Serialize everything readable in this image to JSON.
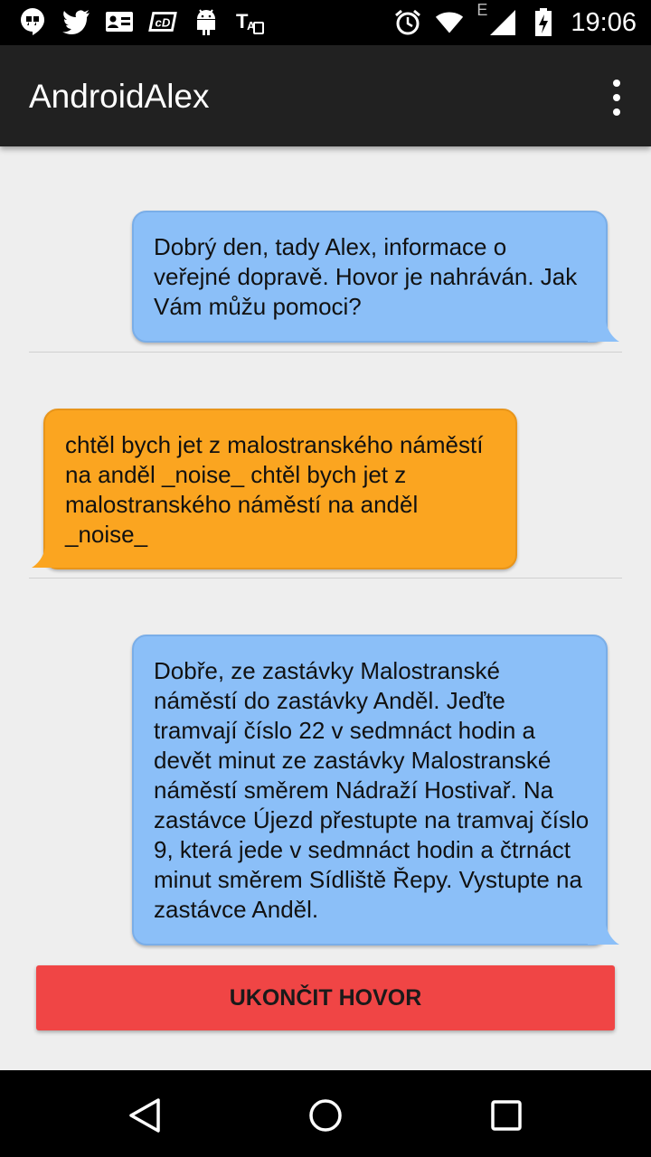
{
  "status_bar": {
    "time": "19:06",
    "network_label": "E",
    "left_icons": [
      "hangouts-icon",
      "twitter-icon",
      "contact-card-icon",
      "cd-icon",
      "android-icon",
      "text-translate-icon"
    ],
    "right_icons": [
      "alarm-icon",
      "wifi-icon",
      "signal-icon",
      "battery-charging-icon"
    ]
  },
  "app_bar": {
    "title": "AndroidAlex",
    "menu_icon": "overflow-menu-icon"
  },
  "messages": [
    {
      "sender": "system",
      "text": "Dobrý den, tady Alex, informace o veřejné dopravě. Hovor je nahráván. Jak Vám můžu pomoci?"
    },
    {
      "sender": "user",
      "text": "chtěl bych jet z malostranského náměstí na anděl _noise_ chtěl bych jet z malostranského náměstí na anděl _noise_"
    },
    {
      "sender": "system",
      "text": "Dobře, ze zastávky Malostranské náměstí do zastávky Anděl. Jeďte tramvají číslo 22 v sedmnáct hodin a devět minut ze zastávky Malostranské náměstí směrem Nádraží Hostivař. Na zastávce Újezd přestupte na tramvaj číslo 9, která jede v sedmnáct hodin a čtrnáct minut směrem Sídliště Řepy. Vystupte na zastávce Anděl."
    }
  ],
  "end_call_button": "UKONČIT HOVOR",
  "nav_bar": {
    "icons": [
      "back-icon",
      "home-icon",
      "recents-icon"
    ]
  },
  "colors": {
    "system_bubble": "#8bbff8",
    "user_bubble": "#fba520",
    "end_button": "#f04545",
    "app_bar": "#212121",
    "background": "#eeeeee"
  }
}
